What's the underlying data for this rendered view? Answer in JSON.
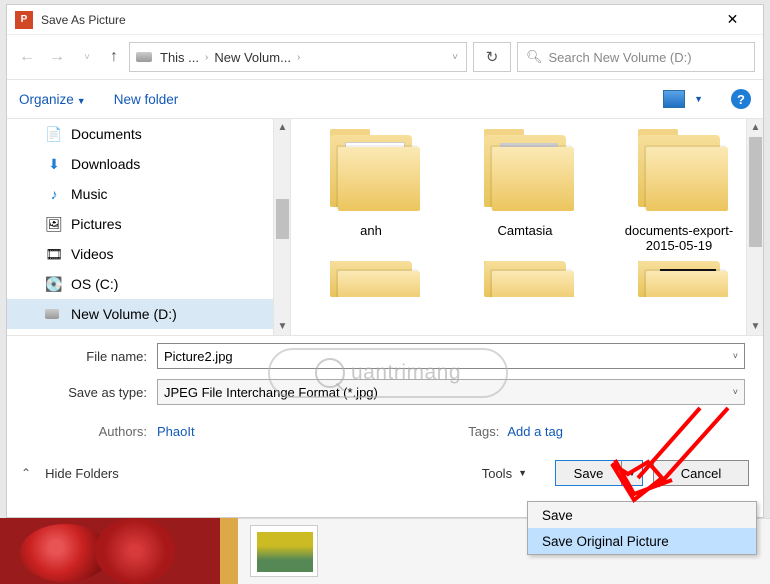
{
  "window": {
    "title": "Save As Picture"
  },
  "nav": {
    "breadcrumb": {
      "seg1": "This ...",
      "seg2": "New Volum..."
    }
  },
  "search": {
    "placeholder": "Search New Volume (D:)"
  },
  "toolbar": {
    "organize": "Organize",
    "new_folder": "New folder"
  },
  "tree": {
    "items": [
      {
        "icon": "doc",
        "label": "Documents"
      },
      {
        "icon": "down",
        "label": "Downloads"
      },
      {
        "icon": "music",
        "label": "Music"
      },
      {
        "icon": "pic",
        "label": "Pictures"
      },
      {
        "icon": "vid",
        "label": "Videos"
      },
      {
        "icon": "disk",
        "label": "OS (C:)"
      },
      {
        "icon": "drive",
        "label": "New Volume (D:)"
      }
    ],
    "selected_index": 6
  },
  "content": {
    "row1": [
      {
        "label": "anh",
        "thumb": "panda"
      },
      {
        "label": "Camtasia",
        "thumb": "cam"
      },
      {
        "label": "documents-export-2015-05-19",
        "thumb": "plain"
      }
    ]
  },
  "form": {
    "file_name_label": "File name:",
    "file_name_value": "Picture2.jpg",
    "save_type_label": "Save as type:",
    "save_type_value": "JPEG File Interchange Format (*.jpg)",
    "authors_label": "Authors:",
    "authors_value": "PhaoIt",
    "tags_label": "Tags:",
    "tags_value": "Add a tag"
  },
  "footer": {
    "hide_folders": "Hide Folders",
    "tools": "Tools",
    "save": "Save",
    "cancel": "Cancel"
  },
  "dropdown": {
    "item1": "Save",
    "item2": "Save Original Picture"
  },
  "watermark_text": "uantrimang"
}
